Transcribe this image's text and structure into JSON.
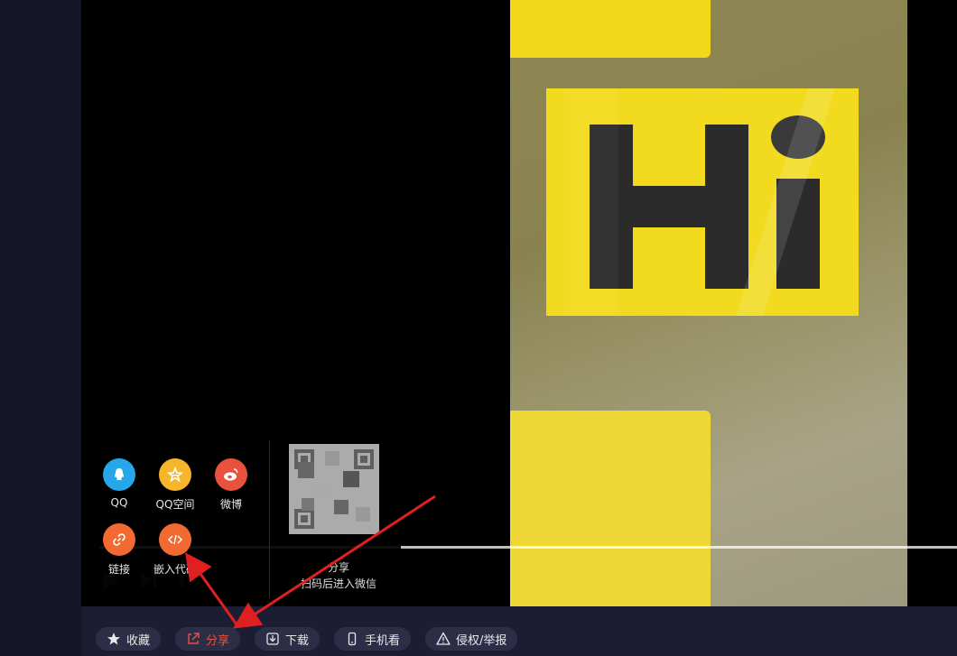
{
  "share_panel": {
    "items": [
      {
        "label": "QQ",
        "icon": "qq-icon",
        "color": "#25a7ea"
      },
      {
        "label": "QQ空间",
        "icon": "qzone-icon",
        "color": "#f7b52a"
      },
      {
        "label": "微博",
        "icon": "weibo-icon",
        "color": "#e8513d"
      },
      {
        "label": "链接",
        "icon": "link-icon",
        "color": "#f26a32"
      },
      {
        "label": "嵌入代码",
        "icon": "embed-code-icon",
        "color": "#f26a32"
      }
    ],
    "qr_caption_line1": "扫码后进入微信",
    "qr_caption_line2": "分享"
  },
  "video": {
    "sign_text": "Hi"
  },
  "toolbar": {
    "favorite_label": "收藏",
    "share_label": "分享",
    "download_label": "下载",
    "mobile_label": "手机看",
    "report_label": "侵权/举报"
  },
  "colors": {
    "accent": "#e8513d",
    "annotation_arrow": "#e02020",
    "toolbar_bg": "#1c1d33",
    "button_bg": "#2c2e48"
  }
}
